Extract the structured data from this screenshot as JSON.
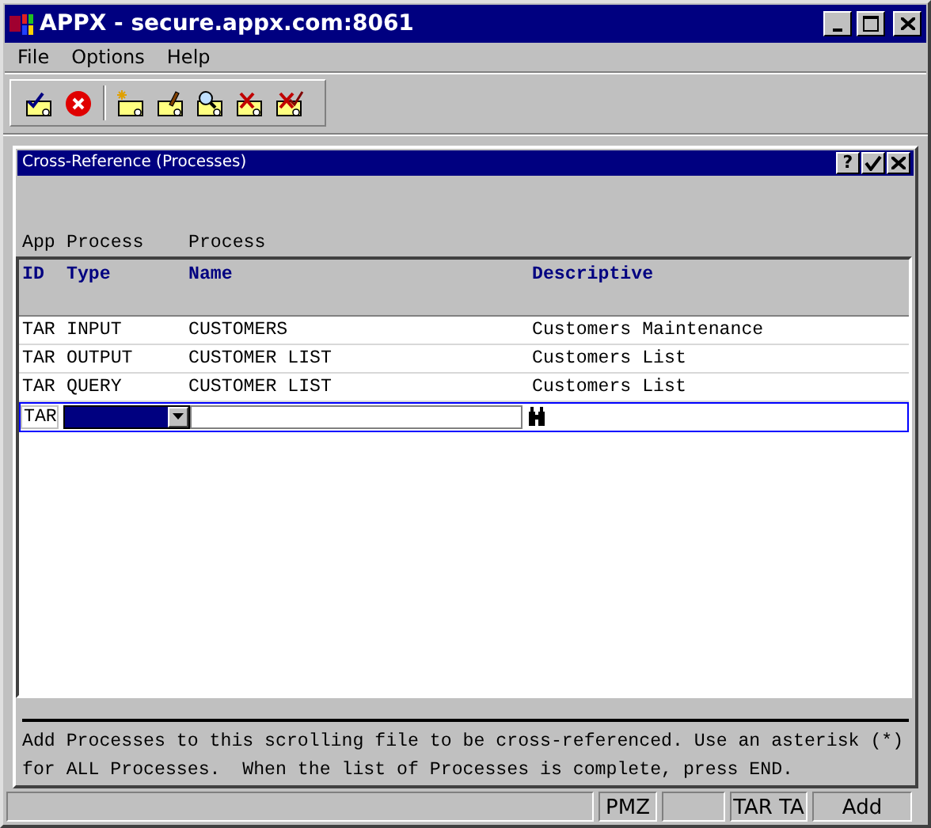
{
  "window": {
    "title": "APPX - secure.appx.com:8061"
  },
  "menu": [
    "File",
    "Options",
    "Help"
  ],
  "dialog": {
    "title": "Cross-Reference (Processes)",
    "help_button": "?",
    "table": {
      "group_labels": [
        "App",
        "Process",
        "Process"
      ],
      "columns": [
        "ID",
        "Type",
        "Name",
        "Descriptive"
      ],
      "rows": [
        [
          "TAR",
          "INPUT",
          "CUSTOMERS",
          "Customers Maintenance"
        ],
        [
          "TAR",
          "OUTPUT",
          "CUSTOMER LIST",
          "Customers List"
        ],
        [
          "TAR",
          "QUERY",
          "CUSTOMER LIST",
          "Customers List"
        ]
      ],
      "entry_row": {
        "app_id": "TAR"
      }
    },
    "help_text": "Add Processes to this scrolling file to be cross-referenced. Use an asterisk (*) for ALL Processes.  When the list of Processes is complete, press END."
  },
  "status_bar": [
    {
      "kind": "blank"
    },
    {
      "kind": "text",
      "text": "PMZ"
    },
    {
      "kind": "blank"
    },
    {
      "kind": "text",
      "text": "TAR TA"
    },
    {
      "kind": "text",
      "text": "Add"
    }
  ]
}
